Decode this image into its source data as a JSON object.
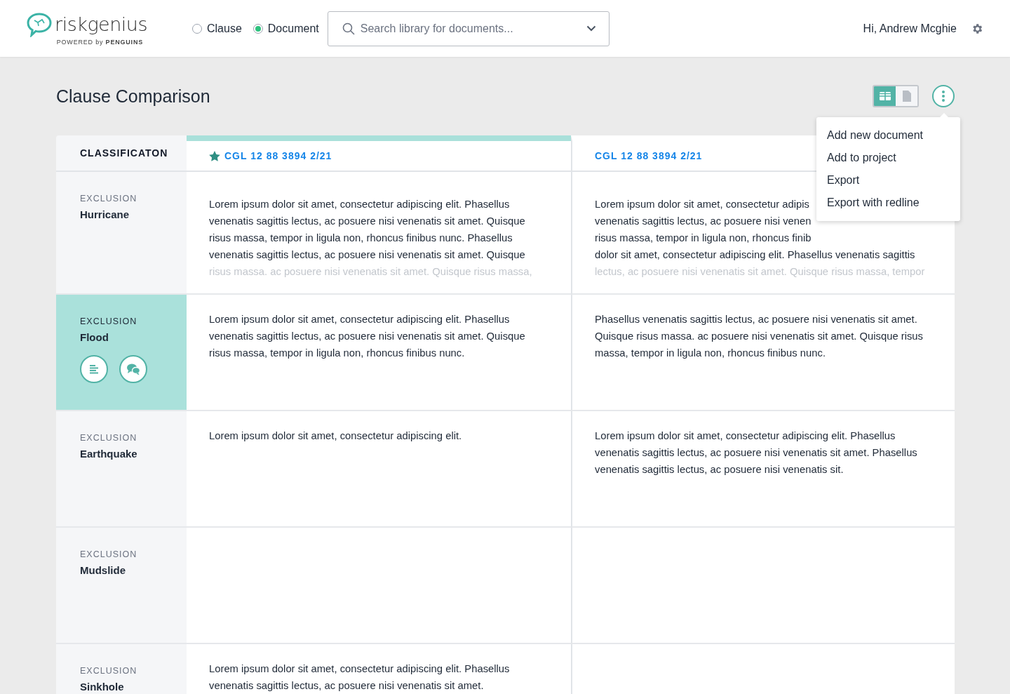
{
  "header": {
    "logo": {
      "name": "riskgenius",
      "tagline_prefix": "POWERED by",
      "tagline_brand": "PENGUINS"
    },
    "search_mode": [
      {
        "label": "Clause",
        "selected": false
      },
      {
        "label": "Document",
        "selected": true
      }
    ],
    "search": {
      "placeholder": "Search library for documents..."
    },
    "greeting": "Hi, Andrew Mcghie"
  },
  "page": {
    "title": "Clause Comparison",
    "view_toggle": [
      {
        "kind": "grid",
        "selected": true
      },
      {
        "kind": "document",
        "selected": false
      }
    ],
    "menu": {
      "open": true,
      "items": [
        "Add new document",
        "Add to project",
        "Export",
        "Export with redline"
      ]
    }
  },
  "table": {
    "classification_heading": "CLASSIFICATON",
    "documents": [
      {
        "title": "CGL 12 88 3894 2/21",
        "starred": true,
        "highlighted": true
      },
      {
        "title": "CGL 12 88 3894 2/21",
        "starred": false,
        "highlighted": false
      }
    ],
    "rows": [
      {
        "category": "EXCLUSION",
        "name": "Hurricane",
        "selected": false,
        "faded": true,
        "cells": [
          [
            "Lorem ipsum dolor sit amet, consectetur adipiscing elit. Phasellus",
            "venenatis sagittis lectus, ac posuere nisi venenatis sit amet. Quisque",
            "risus massa, tempor in ligula non, rhoncus finibus nunc. Phasellus",
            "venenatis sagittis lectus, ac posuere nisi venenatis sit amet. Quisque",
            "risus massa. ac posuere nisi venenatis sit amet. Quisque risus massa,"
          ],
          [
            "Lorem ipsum dolor sit amet, consectetur adipis",
            "venenatis sagittis lectus, ac posuere nisi venen",
            "risus massa, tempor in ligula non, rhoncus finib",
            "dolor sit amet, consectetur adipiscing elit. Phasellus venenatis sagittis",
            "lectus, ac posuere nisi venenatis sit amet. Quisque risus massa, tempor"
          ]
        ]
      },
      {
        "category": "EXCLUSION",
        "name": "Flood",
        "selected": true,
        "cells": [
          [
            "Lorem ipsum dolor sit amet, consectetur adipiscing elit. Phasellus",
            "venenatis sagittis lectus, ac posuere nisi venenatis sit amet. Quisque",
            "risus massa, tempor in ligula non, rhoncus finibus nunc."
          ],
          [
            "Phasellus venenatis sagittis lectus, ac posuere nisi venenatis sit amet.",
            "Quisque risus massa. ac posuere nisi venenatis sit amet. Quisque risus",
            "massa, tempor in ligula non, rhoncus finibus nunc."
          ]
        ]
      },
      {
        "category": "EXCLUSION",
        "name": "Earthquake",
        "selected": false,
        "cells": [
          [
            "Lorem ipsum dolor sit amet, consectetur adipiscing elit."
          ],
          [
            "Lorem ipsum dolor sit amet, consectetur adipiscing elit. Phasellus",
            "venenatis sagittis lectus, ac posuere nisi venenatis sit amet.  Phasellus",
            "venenatis sagittis lectus, ac posuere nisi venenatis sit."
          ]
        ]
      },
      {
        "category": "EXCLUSION",
        "name": "Mudslide",
        "selected": false,
        "cells": []
      },
      {
        "category": "EXCLUSION",
        "name": "Sinkhole",
        "selected": false,
        "cells": [
          [
            "Lorem ipsum dolor sit amet, consectetur adipiscing elit. Phasellus",
            "venenatis sagittis lectus, ac posuere nisi venenatis sit amet."
          ]
        ]
      }
    ]
  }
}
